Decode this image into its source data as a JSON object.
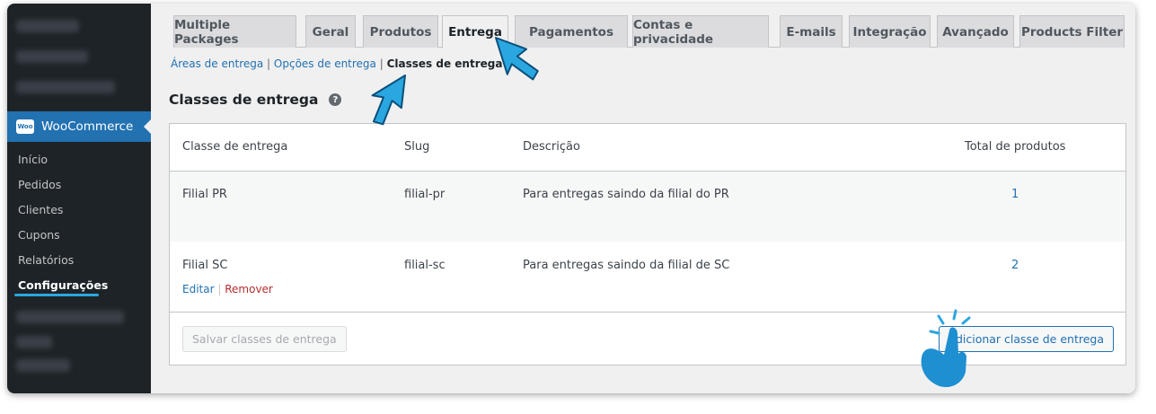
{
  "sidebar": {
    "woocommerce": {
      "logo_text": "Woo",
      "label": "WooCommerce"
    },
    "submenu": [
      {
        "label": "Início"
      },
      {
        "label": "Pedidos"
      },
      {
        "label": "Clientes"
      },
      {
        "label": "Cupons"
      },
      {
        "label": "Relatórios"
      },
      {
        "label": "Configurações",
        "active": true
      }
    ]
  },
  "tabs": [
    {
      "label": "Multiple Packages"
    },
    {
      "label": "Geral"
    },
    {
      "label": "Produtos"
    },
    {
      "label": "Entrega",
      "active": true
    },
    {
      "label": "Pagamentos"
    },
    {
      "label": "Contas e privacidade"
    },
    {
      "label": "E-mails"
    },
    {
      "label": "Integração"
    },
    {
      "label": "Avançado"
    },
    {
      "label": "Products Filter"
    }
  ],
  "subnav": {
    "zones": "Áreas de entrega",
    "options": "Opções de entrega",
    "classes": "Classes de entrega",
    "separator": "|"
  },
  "section": {
    "title": "Classes de entrega",
    "help_glyph": "?"
  },
  "table": {
    "headers": {
      "class": "Classe de entrega",
      "slug": "Slug",
      "description": "Descrição",
      "count": "Total de produtos"
    },
    "rows": [
      {
        "name": "Filial PR",
        "slug": "filial-pr",
        "description": "Para entregas saindo da filial do PR",
        "count": "1"
      },
      {
        "name": "Filial SC",
        "slug": "filial-sc",
        "description": "Para entregas saindo da filial de SC",
        "count": "2"
      }
    ],
    "row_actions": {
      "edit": "Editar",
      "separator": "|",
      "remove": "Remover"
    },
    "save_button": "Salvar classes de entrega",
    "add_button": "Adicionar classe de entrega"
  },
  "colors": {
    "accent": "#2271b1",
    "sidebar_bg": "#1d2327",
    "annotation": "#2aa7e0",
    "remove": "#b32d2e"
  }
}
